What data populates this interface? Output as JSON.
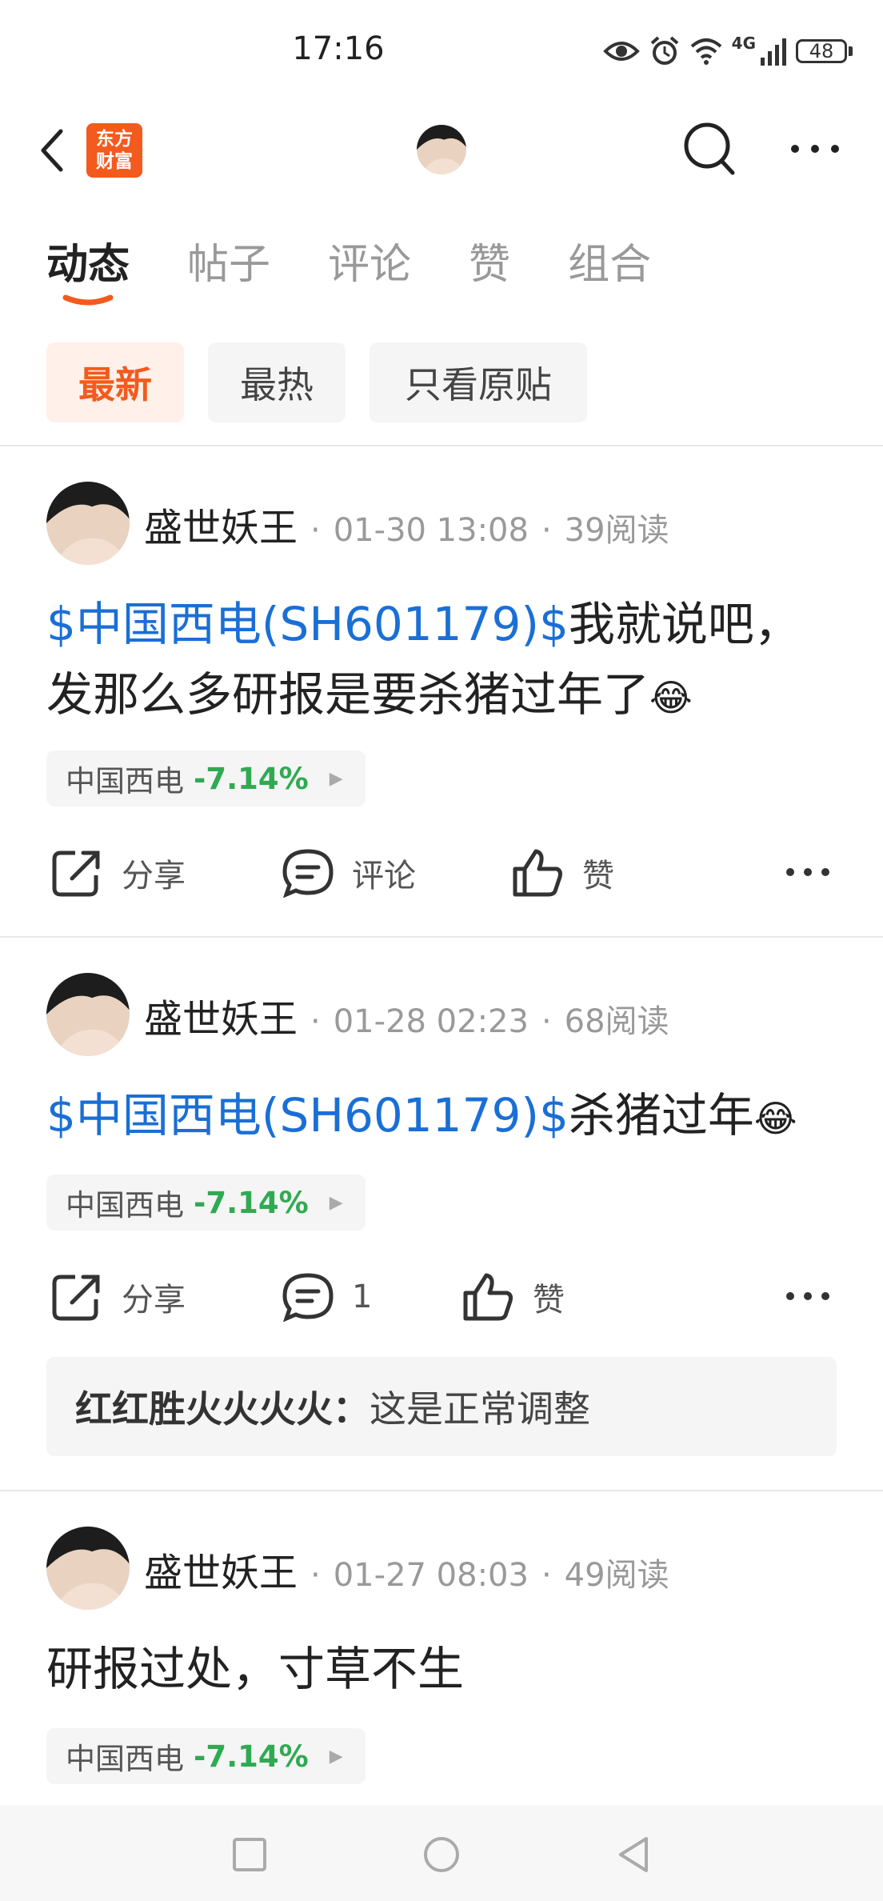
{
  "status_bar": {
    "time": "17:16",
    "network": "4G",
    "battery": "48"
  },
  "header": {
    "logo_text_line1": "东方",
    "logo_text_line2": "财富"
  },
  "tabs": [
    {
      "label": "动态",
      "active": true
    },
    {
      "label": "帖子",
      "active": false
    },
    {
      "label": "评论",
      "active": false
    },
    {
      "label": "赞",
      "active": false
    },
    {
      "label": "组合",
      "active": false
    }
  ],
  "filters": [
    {
      "label": "最新",
      "active": true
    },
    {
      "label": "最热",
      "active": false
    },
    {
      "label": "只看原贴",
      "active": false
    }
  ],
  "posts": [
    {
      "author": "盛世妖王",
      "date": "01-30 13:08",
      "reads": "39阅读",
      "stock_link": "$中国西电(SH601179)$",
      "text_line1": "我就说吧，",
      "text_line2": "发那么多研报是要杀猪过年了",
      "tag": {
        "name": "中国西电",
        "change": "-7.14%"
      },
      "actions": {
        "share": "分享",
        "comment": "评论",
        "like": "赞"
      }
    },
    {
      "author": "盛世妖王",
      "date": "01-28 02:23",
      "reads": "68阅读",
      "stock_link": "$中国西电(SH601179)$",
      "text_line1": "杀猪过年",
      "tag": {
        "name": "中国西电",
        "change": "-7.14%"
      },
      "actions": {
        "share": "分享",
        "comment": "1",
        "like": "赞"
      },
      "comment": {
        "user": "红红胜火火火火：",
        "text": "这是正常调整"
      }
    },
    {
      "author": "盛世妖王",
      "date": "01-27 08:03",
      "reads": "49阅读",
      "text_line1": "研报过处，寸草不生",
      "tag": {
        "name": "中国西电",
        "change": "-7.14%"
      }
    }
  ],
  "colors": {
    "accent": "#f35a1e",
    "link": "#1a6fd6",
    "down": "#2faa52"
  }
}
